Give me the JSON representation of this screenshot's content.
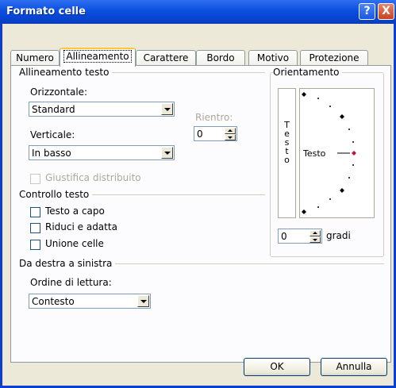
{
  "window": {
    "title": "Formato celle",
    "help_glyph": "?",
    "close_glyph": "X"
  },
  "tabs": [
    {
      "label": "Numero"
    },
    {
      "label": "Allineamento"
    },
    {
      "label": "Carattere"
    },
    {
      "label": "Bordo"
    },
    {
      "label": "Motivo"
    },
    {
      "label": "Protezione"
    }
  ],
  "alignment": {
    "group_label": "Allineamento testo",
    "horizontal_label": "Orizzontale:",
    "horizontal_value": "Standard",
    "vertical_label": "Verticale:",
    "vertical_value": "In basso",
    "indent_label": "Rientro:",
    "indent_value": "0",
    "justify_distributed": "Giustifica distribuito"
  },
  "text_control": {
    "group_label": "Controllo testo",
    "wrap": "Testo a capo",
    "shrink": "Riduci e adatta",
    "merge": "Unione celle"
  },
  "rtl": {
    "group_label": "Da destra a sinistra",
    "reading_order_label": "Ordine di lettura:",
    "reading_order_value": "Contesto"
  },
  "orientation": {
    "group_label": "Orientamento",
    "vertical_text": [
      "T",
      "e",
      "s",
      "t",
      "o"
    ],
    "dial_text": "Testo",
    "degrees_value": "0",
    "degrees_label": "gradi"
  },
  "footer": {
    "ok": "OK",
    "cancel": "Annulla"
  },
  "colors": {
    "titlebar": "#0b4fe0",
    "dialog_bg": "#ece9d8",
    "active_tab_accent": "#ffc83c",
    "dial_marker": "#c0143c"
  }
}
